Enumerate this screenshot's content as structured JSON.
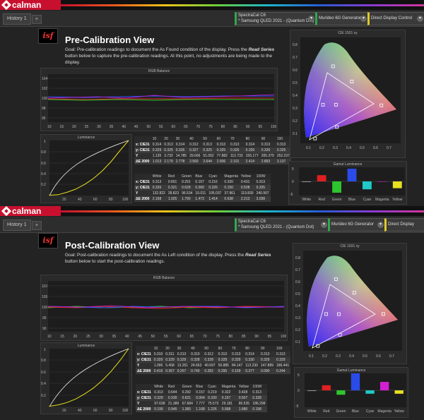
{
  "app": {
    "brand": "calman",
    "history_tab": "History 1",
    "add_tab": "+"
  },
  "devices": {
    "meter_l1": "SpectraCal C6",
    "meter_l2": "* Samsung QLED 2021 - (Quantum Dot)",
    "generator": "Murideo 6G Generator",
    "display": "Direct Display Control"
  },
  "colors": {
    "accent": "#c8102e",
    "white": "#e6e6e6",
    "red": "#e02020",
    "green": "#2ec42e",
    "blue": "#2a4be8",
    "cyan": "#20c8c8",
    "magenta": "#d020d0",
    "yellow": "#e8e020",
    "plot_bg": "#1d1d1d"
  },
  "pre": {
    "logo": "isf",
    "title": "Pre-Calibration View",
    "goal_pre": "Goal: Pre-calibration readings to document the As Found condition of the display. Press the ",
    "goal_em": "Read Series",
    "goal_post": " button below to capture the pre-calibration readings. At this point, no adjustments are being made to the display.",
    "rgb_title": "RGB Balance",
    "lum_title": "Luminance",
    "cie_title": "CIE 1931 xy",
    "gamut_title": "Gamut Luminance",
    "gray": {
      "headers": [
        "",
        "10",
        "20",
        "30",
        "40",
        "50",
        "60",
        "70",
        "80",
        "90",
        "100"
      ],
      "rows": [
        [
          "x: CIE31",
          "0.314",
          "0.313",
          "0.314",
          "0.312",
          "0.313",
          "0.313",
          "0.313",
          "0.314",
          "0.313",
          "0.313"
        ],
        [
          "y: CIE31",
          "0.329",
          "0.325",
          "0.326",
          "0.327",
          "0.325",
          "0.325",
          "0.326",
          "0.326",
          "0.326",
          "0.325"
        ],
        [
          "Y",
          "1.135",
          "3.732",
          "14.785",
          "29.606",
          "51.052",
          "77.882",
          "112.733",
          "155.177",
          "205.379",
          "252.237"
        ],
        [
          "ΔE 2000",
          "1.013",
          "2.179",
          "2.778",
          "2.560",
          "2.644",
          "2.606",
          "2.101",
          "2.414",
          "2.893",
          "3.137"
        ]
      ]
    },
    "color": {
      "headers": [
        "",
        "White",
        "Red",
        "Green",
        "Blue",
        "Cyan",
        "Magenta",
        "Yellow",
        "100W"
      ],
      "rows": [
        [
          "x: CIE31",
          "0.313",
          "0.651",
          "0.291",
          "0.157",
          "0.216",
          "0.320",
          "0.431",
          "0.313"
        ],
        [
          "y: CIE31",
          "0.326",
          "0.321",
          "0.628",
          "0.060",
          "0.326",
          "0.150",
          "0.508",
          "0.325"
        ],
        [
          "Y",
          "132.822",
          "28.823",
          "96.534",
          "10.011",
          "105.037",
          "37.961",
          "119.830",
          "240.907"
        ],
        [
          "ΔE 2000",
          "2.168",
          "1.025",
          "1.790",
          "1.473",
          "1.414",
          "0.638",
          "2.213",
          "3.038"
        ]
      ]
    },
    "rgb_y_ticks": [
      "104",
      "102",
      "100",
      "98",
      "96"
    ],
    "rgb_x_ticks": [
      "10",
      "15",
      "20",
      "25",
      "30",
      "35",
      "40",
      "45",
      "50",
      "55",
      "60",
      "65",
      "70",
      "75",
      "80",
      "85",
      "90",
      "95",
      "100"
    ],
    "lum_x_ticks": [
      "20",
      "40",
      "60",
      "80",
      "100"
    ],
    "lum_y_ticks": [
      "1",
      "0.8",
      "0.6",
      "0.4",
      "0.2"
    ],
    "cie_x_ticks": [
      "0.1",
      "0.2",
      "0.3",
      "0.4",
      "0.5",
      "0.6",
      "0.7"
    ],
    "cie_y_ticks": [
      "0.8",
      "0.7",
      "0.6",
      "0.5",
      "0.4",
      "0.3",
      "0.2",
      "0.1"
    ],
    "gamut_y_ticks": [
      "5",
      "0",
      "-5"
    ],
    "gamut_labels": [
      "White",
      "Red",
      "Green",
      "Blue",
      "Cyan",
      "Magenta",
      "Yellow"
    ]
  },
  "post": {
    "logo": "isf",
    "title": "Post-Calibration View",
    "goal_pre": "Goal: Post-calibration readings to document the As Left condition of the display. Press the ",
    "goal_em": "Read Series",
    "goal_post": " button below to start the post-calibration readings.",
    "rgb_title": "RGB Balance",
    "lum_title": "Luminance",
    "cie_title": "CIE 1931 xy",
    "gamut_title": "Gamut Luminance",
    "gray": {
      "headers": [
        "",
        "10",
        "20",
        "30",
        "40",
        "50",
        "60",
        "70",
        "80",
        "90",
        "100"
      ],
      "rows": [
        [
          "x: CIE31",
          "0.310",
          "0.311",
          "0.313",
          "0.310",
          "0.312",
          "0.313",
          "0.313",
          "0.314",
          "0.313",
          "0.313"
        ],
        [
          "y: CIE31",
          "0.329",
          "0.329",
          "0.329",
          "0.328",
          "0.328",
          "0.328",
          "0.329",
          "0.330",
          "0.329",
          "0.329"
        ],
        [
          "Y",
          "1.096",
          "5.458",
          "13.251",
          "24.663",
          "40.697",
          "59.885",
          "84.147",
          "113.230",
          "147.889",
          "186.441"
        ],
        [
          "ΔE 2000",
          "0.416",
          "0.367",
          "0.257",
          "0.740",
          "0.282",
          "0.295",
          "0.159",
          "0.377",
          "0.090",
          "0.244"
        ]
      ]
    },
    "color": {
      "headers": [
        "",
        "White",
        "Red",
        "Green",
        "Blue",
        "Cyan",
        "Magenta",
        "Yellow",
        "100W"
      ],
      "rows": [
        [
          "x: CIE31",
          "0.313",
          "0.644",
          "0.292",
          "0.157",
          "0.219",
          "0.322",
          "0.428",
          "0.313"
        ],
        [
          "y: CIE31",
          "0.329",
          "0.330",
          "0.621",
          "0.064",
          "0.330",
          "0.157",
          "0.507",
          "0.328"
        ],
        [
          "Y",
          "97.638",
          "21.389",
          "67.684",
          "7.777",
          "75.573",
          "29.181",
          "80.535",
          "186.298"
        ],
        [
          "ΔE 2000",
          "0.199",
          "0.945",
          "1.365",
          "1.168",
          "1.226",
          "0.968",
          "1.680",
          "0.158"
        ]
      ]
    },
    "rgb_y_ticks": [
      "110",
      "105",
      "100",
      "95",
      "90"
    ],
    "rgb_x_ticks": [
      "10",
      "15",
      "20",
      "25",
      "30",
      "35",
      "40",
      "45",
      "50",
      "55",
      "60",
      "65",
      "70",
      "75",
      "80",
      "85",
      "90",
      "95",
      "100"
    ],
    "lum_x_ticks": [
      "20",
      "40",
      "60",
      "80",
      "100"
    ],
    "lum_y_ticks": [
      "1",
      "0.8",
      "0.6",
      "0.4",
      "0.2"
    ],
    "cie_x_ticks": [
      "0.1",
      "0.2",
      "0.3",
      "0.4",
      "0.5",
      "0.6",
      "0.7"
    ],
    "cie_y_ticks": [
      "0.8",
      "0.7",
      "0.6",
      "0.5",
      "0.4",
      "0.3",
      "0.2",
      "0.1"
    ],
    "gamut_y_ticks": [
      "5",
      "0",
      "-5"
    ],
    "gamut_labels": [
      "White",
      "Red",
      "Green",
      "Blue",
      "Cyan",
      "Magenta",
      "Yellow"
    ]
  },
  "chart_data": [
    {
      "panel": "pre",
      "name": "gamut-luminance",
      "type": "bar",
      "title": "Gamut Luminance",
      "categories": [
        "White",
        "Red",
        "Green",
        "Blue",
        "Cyan",
        "Magenta",
        "Yellow"
      ],
      "values": [
        0,
        2.2,
        -4.0,
        4.5,
        -2.8,
        0,
        -2.4
      ],
      "ylim": [
        -5,
        5
      ]
    },
    {
      "panel": "pre",
      "name": "luminance",
      "type": "line",
      "title": "Luminance",
      "x": [
        10,
        20,
        30,
        40,
        50,
        60,
        70,
        80,
        90,
        100
      ],
      "series": [
        {
          "values": [
            0.005,
            0.015,
            0.059,
            0.117,
            0.202,
            0.309,
            0.447,
            0.615,
            0.814,
            1.0
          ]
        }
      ],
      "ylim": [
        0,
        1
      ]
    },
    {
      "panel": "pre",
      "name": "cie",
      "type": "scatter",
      "title": "CIE 1931 xy",
      "x": [
        0.651,
        0.291,
        0.157,
        0.216,
        0.32,
        0.431,
        0.313
      ],
      "y": [
        0.321,
        0.628,
        0.06,
        0.326,
        0.15,
        0.508,
        0.326
      ]
    },
    {
      "panel": "post",
      "name": "gamut-luminance",
      "type": "bar",
      "title": "Gamut Luminance",
      "categories": [
        "White",
        "Red",
        "Green",
        "Blue",
        "Cyan",
        "Magenta",
        "Yellow"
      ],
      "values": [
        0,
        1.5,
        -1.3,
        5.0,
        -1.0,
        2.5,
        -1.0
      ],
      "ylim": [
        -5,
        5
      ]
    },
    {
      "panel": "post",
      "name": "luminance",
      "type": "line",
      "title": "Luminance",
      "x": [
        10,
        20,
        30,
        40,
        50,
        60,
        70,
        80,
        90,
        100
      ],
      "series": [
        {
          "values": [
            0.006,
            0.029,
            0.071,
            0.132,
            0.218,
            0.321,
            0.451,
            0.607,
            0.793,
            1.0
          ]
        }
      ],
      "ylim": [
        0,
        1
      ]
    },
    {
      "panel": "post",
      "name": "cie",
      "type": "scatter",
      "title": "CIE 1931 xy",
      "x": [
        0.644,
        0.292,
        0.157,
        0.219,
        0.322,
        0.428,
        0.313
      ],
      "y": [
        0.33,
        0.621,
        0.064,
        0.33,
        0.157,
        0.507,
        0.329
      ]
    }
  ]
}
